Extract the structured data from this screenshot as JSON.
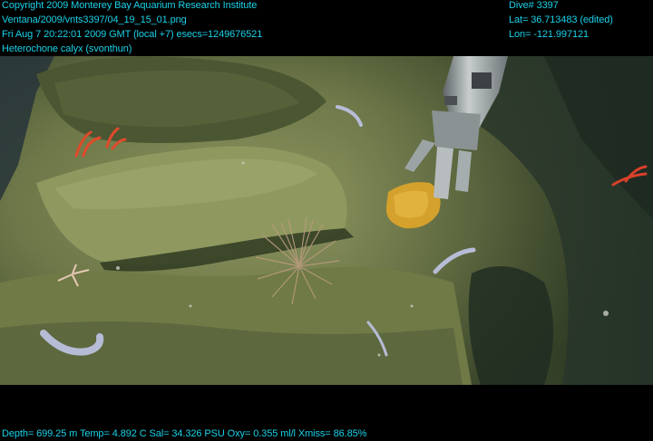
{
  "overlay": {
    "left_lines": [
      "Copyright 2009 Monterey Bay Aquarium Research Institute",
      "Ventana/2009/vnts3397/04_19_15_01.png",
      "Fri Aug  7 20:22:01 2009 GMT (local +7)  esecs=1249676521",
      "Heterochone calyx (svonthun)"
    ],
    "right_lines": [
      "Dive# 3397",
      "Lat= 36.713483 (edited)",
      "Lon= -121.997121"
    ],
    "bottom_line": "Depth= 699.25 m  Temp= 4.892 C  Sal= 34.326 PSU  Oxy= 0.355 ml/l  Xmiss= 86.85%"
  },
  "colors": {
    "overlay_text": "#19d2e8",
    "bar_background": "#000000",
    "seafloor": "#59643c",
    "sponge": "#d4a12c",
    "manipulator": "#9aa2a4",
    "coral_red": "#e04a2a"
  }
}
